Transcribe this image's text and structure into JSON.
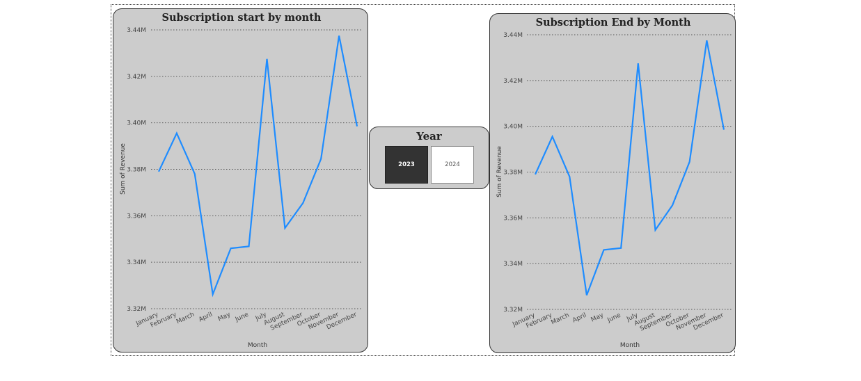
{
  "year_slicer": {
    "title": "Year",
    "options": [
      "2023",
      "2024"
    ],
    "selected": "2023"
  },
  "colors": {
    "card_background": "#cccccc",
    "line": "#1e8cff",
    "slicer_selected": "#333333"
  },
  "chart_data": [
    {
      "type": "line",
      "title": "Subscription start by month",
      "xlabel": "Month",
      "ylabel": "Sum of Revenue",
      "categories": [
        "January",
        "February",
        "March",
        "April",
        "May",
        "June",
        "July",
        "August",
        "September",
        "October",
        "November",
        "December"
      ],
      "values": [
        3.379,
        3.3955,
        3.378,
        3.3262,
        3.346,
        3.3468,
        3.4275,
        3.3547,
        3.3655,
        3.3845,
        3.4375,
        3.3985
      ],
      "y_unit": "M",
      "ylim": [
        3.32,
        3.44
      ],
      "y_ticks": [
        "3.32M",
        "3.34M",
        "3.36M",
        "3.38M",
        "3.40M",
        "3.42M",
        "3.44M"
      ],
      "grid": true
    },
    {
      "type": "line",
      "title": "Subscription End by Month",
      "xlabel": "Month",
      "ylabel": "Sum of Revenue",
      "categories": [
        "January",
        "February",
        "March",
        "April",
        "May",
        "June",
        "July",
        "August",
        "September",
        "October",
        "November",
        "December"
      ],
      "values": [
        3.379,
        3.3955,
        3.378,
        3.3262,
        3.346,
        3.3468,
        3.4275,
        3.3547,
        3.3655,
        3.3845,
        3.4375,
        3.3985
      ],
      "y_unit": "M",
      "ylim": [
        3.32,
        3.44
      ],
      "y_ticks": [
        "3.32M",
        "3.34M",
        "3.36M",
        "3.38M",
        "3.40M",
        "3.42M",
        "3.44M"
      ],
      "grid": true
    }
  ]
}
